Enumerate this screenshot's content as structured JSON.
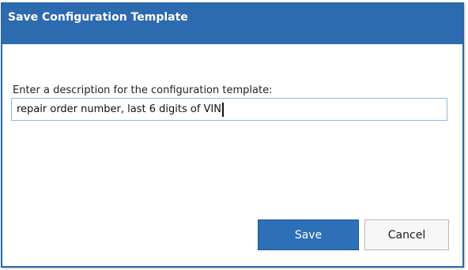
{
  "dialog": {
    "title": "Save Configuration Template",
    "prompt": "Enter a description for the configuration template:",
    "input_value": "repair order number, last 6 digits of VIN",
    "buttons": {
      "save_label": "Save",
      "cancel_label": "Cancel"
    }
  },
  "colors": {
    "titlebar": "#2d6bb0",
    "save_button": "#2e70b8",
    "input_border": "#8fb8e0"
  }
}
